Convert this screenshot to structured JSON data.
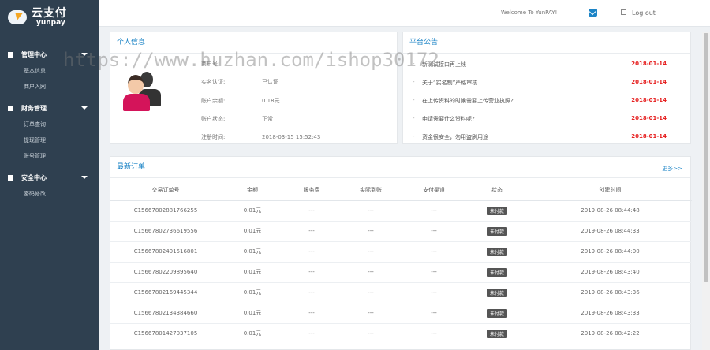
{
  "brand": {
    "name": "云支付",
    "sub": "yunpay"
  },
  "sidebar": {
    "groups": [
      {
        "title": "管理中心",
        "items": [
          "基本信息",
          "商户入网"
        ]
      },
      {
        "title": "财务管理",
        "items": [
          "订单查询",
          "提现管理",
          "账号管理"
        ]
      },
      {
        "title": "安全中心",
        "items": [
          "密码修改"
        ]
      }
    ]
  },
  "topbar": {
    "welcome": "Welcome To YunPAY!",
    "logout": "Log out"
  },
  "info": {
    "title": "个人信息",
    "rows": [
      {
        "label": "商户号:",
        "value": ""
      },
      {
        "label": "实名认证:",
        "value": "已认证"
      },
      {
        "label": "账户余额:",
        "value": "0.18元"
      },
      {
        "label": "账户状态:",
        "value": "正常"
      },
      {
        "label": "注册时间:",
        "value": "2018-03-15 15:52:43"
      }
    ]
  },
  "notice": {
    "title": "平台公告",
    "items": [
      {
        "text": "新测试接口再上线",
        "date": "2018-01-14"
      },
      {
        "text": "关于“实名制”严格审核",
        "date": "2018-01-14"
      },
      {
        "text": "在上传资料的时候需要上传营业执照?",
        "date": "2018-01-14"
      },
      {
        "text": "申请需要什么资料呢?",
        "date": "2018-01-14"
      },
      {
        "text": "资金很安全，勿用盗刷用途",
        "date": "2018-01-14"
      }
    ]
  },
  "orders": {
    "title": "最新订单",
    "more": "更多>>",
    "columns": [
      "交易订单号",
      "金额",
      "服务费",
      "实际到账",
      "支付渠道",
      "状态",
      "创建时间"
    ],
    "rows": [
      [
        "C15667802881766255",
        "0.01元",
        "---",
        "---",
        "---",
        "未付款",
        "2019-08-26 08:44:48"
      ],
      [
        "C15667802736619556",
        "0.01元",
        "---",
        "---",
        "---",
        "未付款",
        "2019-08-26 08:44:33"
      ],
      [
        "C15667802401516801",
        "0.01元",
        "---",
        "---",
        "---",
        "未付款",
        "2019-08-26 08:44:00"
      ],
      [
        "C15667802209895640",
        "0.01元",
        "---",
        "---",
        "---",
        "未付款",
        "2019-08-26 08:43:40"
      ],
      [
        "C15667802169445344",
        "0.01元",
        "---",
        "---",
        "---",
        "未付款",
        "2019-08-26 08:43:36"
      ],
      [
        "C15667802134384660",
        "0.01元",
        "---",
        "---",
        "---",
        "未付款",
        "2019-08-26 08:43:33"
      ],
      [
        "C15667801427037105",
        "0.01元",
        "---",
        "---",
        "---",
        "未付款",
        "2019-08-26 08:42:22"
      ]
    ]
  },
  "watermark": "https://www.huzhan.com/ishop30172",
  "colors": {
    "sidebar": "#2f4050",
    "accent": "#1c84c6",
    "date": "#e61e1e"
  }
}
